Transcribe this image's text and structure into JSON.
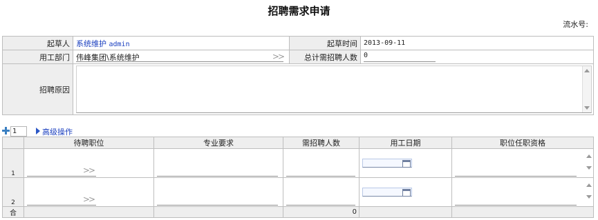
{
  "page": {
    "title": "招聘需求申请",
    "serial_label": "流水号:"
  },
  "form": {
    "drafter_label": "起草人",
    "drafter_value": "系统维护",
    "drafter_account": "admin",
    "draft_time_label": "起草时间",
    "draft_time_value": "2013-09-11",
    "dept_label": "用工部门",
    "dept_value": "伟峰集团\\系统维护",
    "chevron": ">>",
    "total_label": "总计需招聘人数",
    "total_value": "0",
    "reason_label": "招聘原因",
    "reason_value": ""
  },
  "toolbar": {
    "row_count": "1",
    "advanced_label": "高级操作"
  },
  "grid": {
    "headers": [
      "待聘职位",
      "专业要求",
      "需招聘人数",
      "用工日期",
      "职位任职资格"
    ],
    "rows": [
      {
        "no": "1",
        "position": "",
        "major": "",
        "count": "",
        "date": "",
        "qualification": ""
      },
      {
        "no": "2",
        "position": "",
        "major": "",
        "count": "",
        "date": "",
        "qualification": ""
      }
    ],
    "footer": {
      "label": "合",
      "count_total": "0"
    }
  },
  "icons": {
    "add": "plus-icon",
    "expand": "triangle-right-icon",
    "select": "chevron-double-right-icon",
    "calendar": "calendar-icon"
  },
  "colors": {
    "label_bg": "#eeeeee",
    "link_blue": "#1a3fbf",
    "border": "#bdbdbd",
    "icon_blue": "#3a7fc1"
  }
}
